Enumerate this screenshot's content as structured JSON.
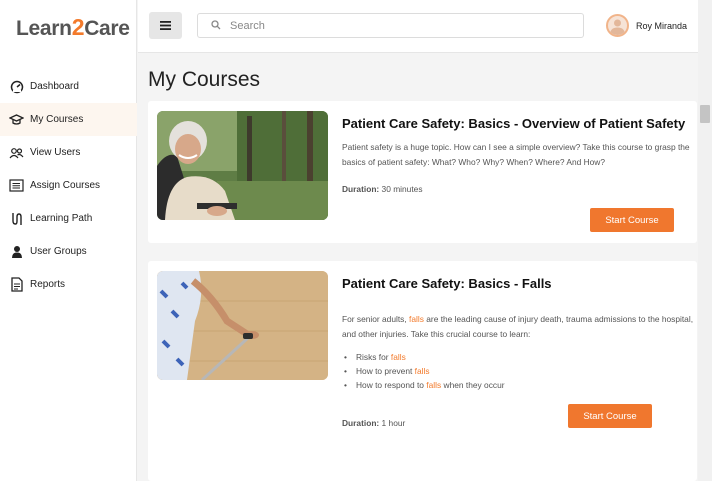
{
  "brand": {
    "logo_left": "Learn",
    "logo_mid": "2",
    "logo_right": "Care",
    "accent": "#f37a2b"
  },
  "sidebar": {
    "items": [
      {
        "label": "Dashboard",
        "icon": "speedometer-icon",
        "active": false
      },
      {
        "label": "My Courses",
        "icon": "graduation-cap-icon",
        "active": true
      },
      {
        "label": "View Users",
        "icon": "users-icon",
        "active": false
      },
      {
        "label": "Assign Courses",
        "icon": "list-assign-icon",
        "active": false
      },
      {
        "label": "Learning Path",
        "icon": "path-icon",
        "active": false
      },
      {
        "label": "User Groups",
        "icon": "user-icon",
        "active": false
      },
      {
        "label": "Reports",
        "icon": "document-icon",
        "active": false
      }
    ]
  },
  "header": {
    "menu_icon": "hamburger-icon",
    "search_placeholder": "Search",
    "search_value": "",
    "user_name": "Roy Miranda"
  },
  "main": {
    "title": "My Courses",
    "courses": [
      {
        "title": "Patient Care Safety: Basics - Overview of Patient Safety",
        "description": "Patient safety is a huge topic. How can I see a simple overview? Take this course to grasp the basics of patient safety: What? Who?  Why? When? Where? And How?",
        "duration_label": "Duration:",
        "duration_value": "30 minutes",
        "button_label": "Start Course"
      },
      {
        "title": "Patient Care Safety: Basics - Falls",
        "description_parts": {
          "before": "For senior adults, ",
          "highlight": "falls",
          "after": " are the leading cause of injury death, trauma admissions to the hospital, and other injuries. Take this crucial  course to learn:"
        },
        "bullets": [
          {
            "before": "Risks for ",
            "highlight": "falls",
            "after": ""
          },
          {
            "before": "How to prevent ",
            "highlight": "falls",
            "after": ""
          },
          {
            "before": "How to respond to ",
            "highlight": "falls",
            "after": " when they occur"
          }
        ],
        "duration_label": "Duration:",
        "duration_value": "1 hour",
        "button_label": "Start Course"
      }
    ]
  }
}
